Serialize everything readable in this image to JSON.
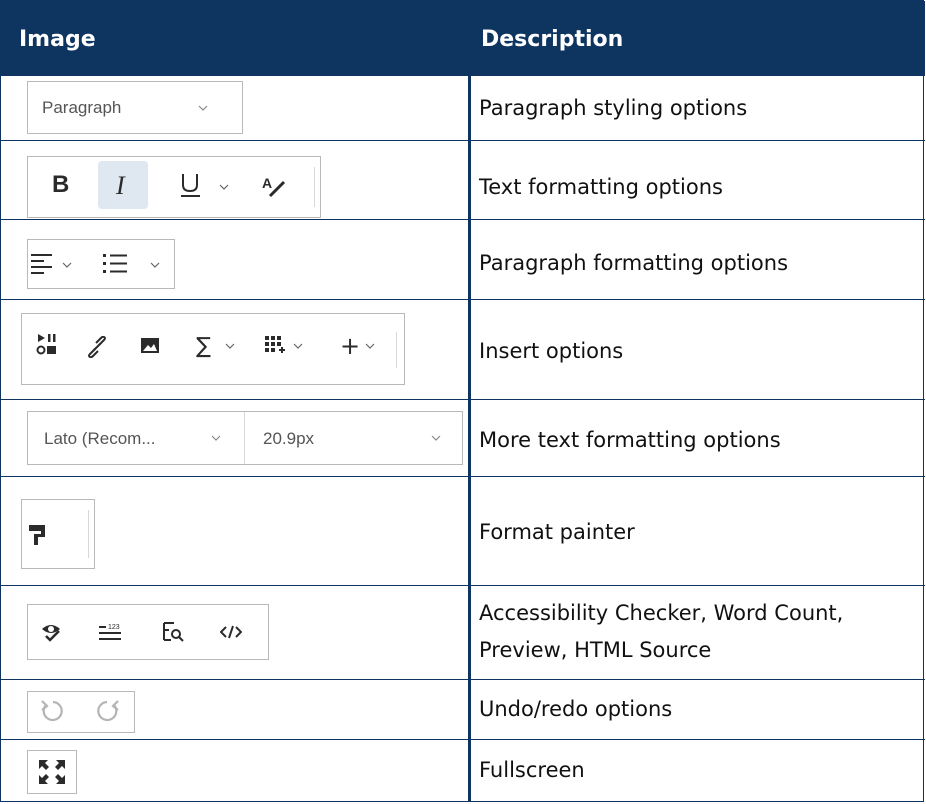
{
  "header": {
    "col_image": "Image",
    "col_description": "Description"
  },
  "rows": [
    {
      "description": "Paragraph styling options",
      "control_text": "Paragraph"
    },
    {
      "description": "Text formatting options",
      "bold": "B",
      "italic": "I"
    },
    {
      "description": "Paragraph formatting options"
    },
    {
      "description": "Insert options"
    },
    {
      "description": "More text formatting options",
      "font_value": "Lato (Recom...",
      "size_value": "20.9px"
    },
    {
      "description": "Format painter"
    },
    {
      "description_line1": "Accessibility Checker, Word Count,",
      "description_line2": "Preview, HTML Source"
    },
    {
      "description": "Undo/redo options"
    },
    {
      "description": "Fullscreen"
    }
  ],
  "icons": {
    "row1": [
      "chevron-down-icon"
    ],
    "row2": [
      "bold-icon",
      "italic-icon",
      "underline-icon",
      "chevron-down-icon",
      "clear-format-icon"
    ],
    "row3": [
      "align-left-icon",
      "chevron-down-icon",
      "bullet-list-icon",
      "chevron-down-icon"
    ],
    "row4": [
      "media-icon",
      "link-icon",
      "image-icon",
      "sigma-icon",
      "chevron-down-icon",
      "table-icon",
      "chevron-down-icon",
      "plus-icon",
      "chevron-down-icon"
    ],
    "row5": [
      "chevron-down-icon",
      "chevron-down-icon"
    ],
    "row6": [
      "paint-roller-icon"
    ],
    "row7": [
      "accessibility-check-icon",
      "word-count-icon",
      "preview-icon",
      "code-icon"
    ],
    "row8": [
      "undo-icon",
      "redo-icon"
    ],
    "row9": [
      "fullscreen-icon"
    ]
  },
  "colors": {
    "header_bg": "#0e3460",
    "header_text": "#ffffff",
    "icon": "#2b2b2b"
  }
}
